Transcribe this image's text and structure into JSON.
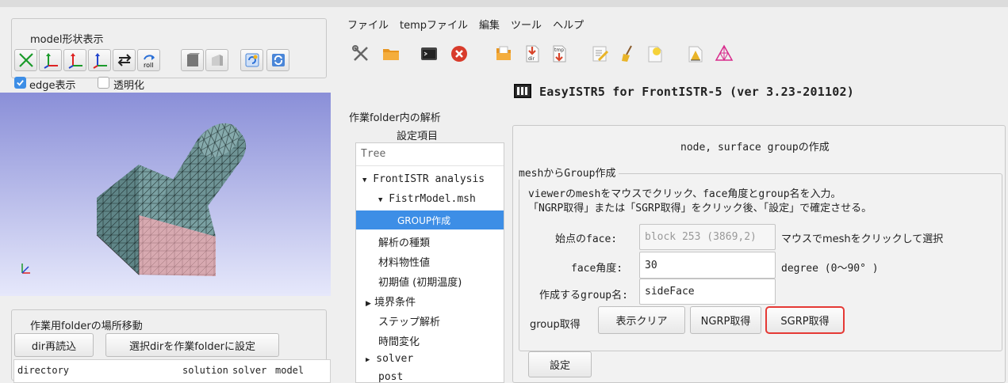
{
  "left_panel": {
    "shape_group_title": "model形状表示",
    "toolbar_icons": [
      "fit-icon",
      "x-axis-view-icon",
      "y-axis-view-icon",
      "z-axis-view-icon",
      "swap-icon",
      "roll-icon",
      "solid-cube-icon",
      "shaded-cube-icon",
      "reload-model-icon",
      "refresh-icon"
    ],
    "roll_text": "roll",
    "edge_checkbox": {
      "label": "edge表示",
      "checked": true
    },
    "transparent_checkbox": {
      "label": "透明化",
      "checked": false
    },
    "axis_label": "YZ\nX",
    "folder_group_title": "作業用folderの場所移動",
    "reload_dir_label": "dir再読込",
    "set_folder_label": "選択dirを作業folderに設定",
    "dir_table_headers": [
      "directory",
      "solution",
      "solver",
      "model"
    ]
  },
  "menu": [
    "ファイル",
    "tempファイル",
    "編集",
    "ツール",
    "ヘルプ"
  ],
  "toolbar_icons": [
    "tools-icon",
    "folder-icon",
    "terminal-icon",
    "close-icon",
    "open-file-icon",
    "dir-icon",
    "tmp-icon",
    "edit-icon",
    "clean-icon",
    "new-file-icon",
    "report-icon",
    "mesh-icon"
  ],
  "dir_icon_text": "dir",
  "tmp_icon_text": "tmp",
  "app_title": "EasyISTR5 for FrontISTR-5  (ver 3.23-201102)",
  "analysis_group_title": "作業folder内の解析",
  "settings_label": "設定項目",
  "tree": {
    "header": "Tree",
    "items": [
      {
        "label": "FrontISTR analysis",
        "arrow": "▼"
      },
      {
        "label": "FistrModel.msh",
        "arrow": "▼"
      },
      {
        "label": "GROUP作成",
        "selected": true
      },
      {
        "label": "解析の種類"
      },
      {
        "label": "材料物性値"
      },
      {
        "label": "初期値 (初期温度)"
      },
      {
        "label": "境界条件",
        "arrow": "▶"
      },
      {
        "label": "ステップ解析"
      },
      {
        "label": "時間変化"
      },
      {
        "label": "solver",
        "arrow": "▶"
      },
      {
        "label": "post"
      }
    ]
  },
  "panel": {
    "title": "node, surface groupの作成",
    "mesh_group_title": "meshからGroup作成",
    "instruction1": "viewerのmeshをマウスでクリック、face角度とgroup名を入力。",
    "instruction2": "「NGRP取得」または「SGRP取得」をクリック後、「設定」で確定させる。",
    "start_face_label": "始点のface:",
    "start_face_value": "block 253 (3869,2)",
    "start_face_hint": "マウスでmeshをクリックして選択",
    "angle_label": "face角度:",
    "angle_value": "30",
    "angle_hint": "degree (0〜90° )",
    "group_name_label": "作成するgroup名:",
    "group_name_value": "sideFace",
    "group_get_label": "group取得",
    "clear_button": "表示クリア",
    "ngrp_button": "NGRP取得",
    "sgrp_button": "SGRP取得",
    "set_button": "設定"
  },
  "colors": {
    "selection": "#3d8ee6",
    "highlight": "#e53935",
    "mesh": "#6f9496",
    "mesh_bottom": "#d7a9b0"
  }
}
